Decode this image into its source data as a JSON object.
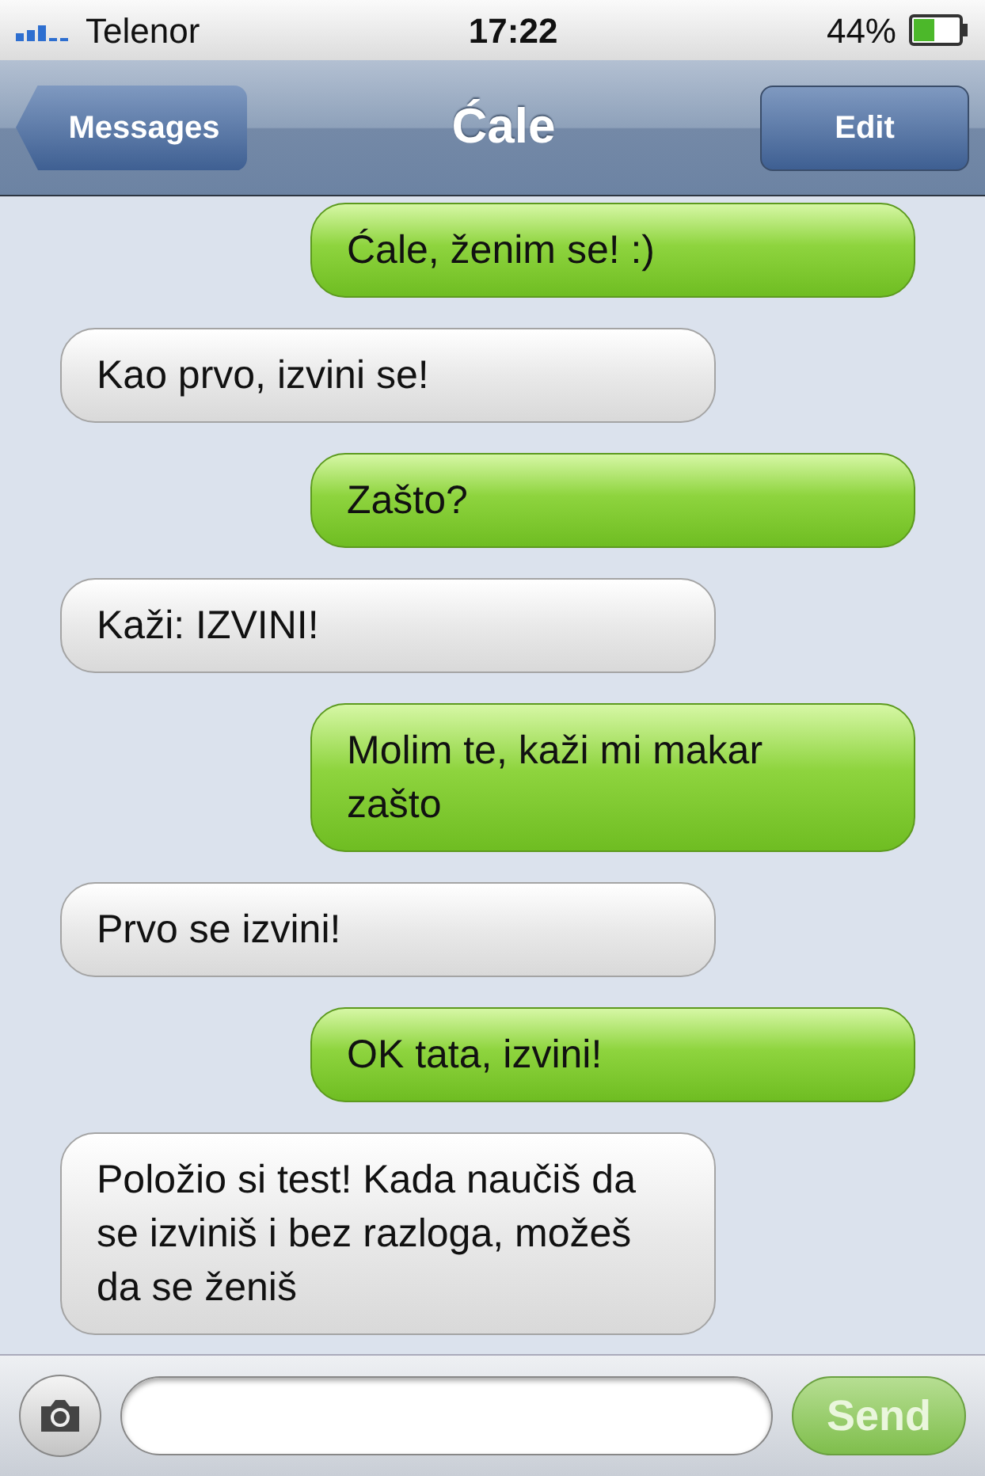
{
  "status_bar": {
    "carrier": "Telenor",
    "time": "17:22",
    "battery": "44%"
  },
  "nav": {
    "back": "Messages",
    "title": "Ćale",
    "edit": "Edit"
  },
  "messages": [
    {
      "kind": "sent",
      "text": "Ćale, ženim se! :)"
    },
    {
      "kind": "received",
      "text": "Kao prvo, izvini se!"
    },
    {
      "kind": "sent",
      "text": "Zašto?"
    },
    {
      "kind": "received",
      "text": "Kaži: IZVINI!"
    },
    {
      "kind": "sent",
      "text": "Molim te, kaži mi makar zašto"
    },
    {
      "kind": "received",
      "text": "Prvo se izvini!"
    },
    {
      "kind": "sent",
      "text": "OK tata, izvini!"
    },
    {
      "kind": "received",
      "text": "Položio si test! Kada naučiš da se izviniš i bez razloga, možeš da se ženiš"
    }
  ],
  "composer": {
    "send": "Send"
  }
}
